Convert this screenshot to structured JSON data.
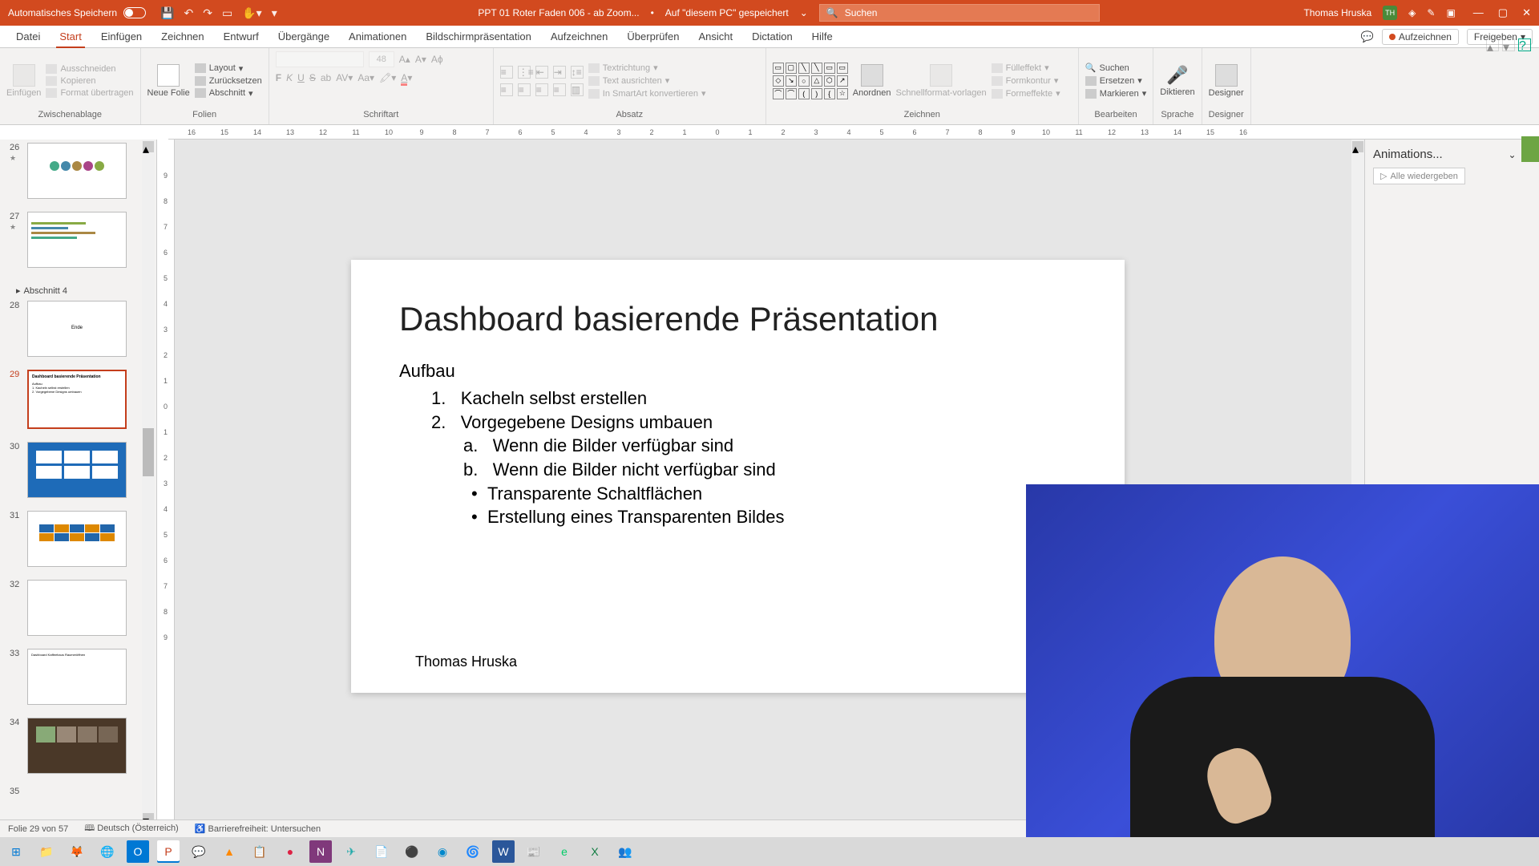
{
  "title_bar": {
    "autosave": "Automatisches Speichern",
    "filename": "PPT 01 Roter Faden 006 - ab Zoom...",
    "saved_location": "Auf \"diesem PC\" gespeichert",
    "search_placeholder": "Suchen",
    "user_name": "Thomas Hruska",
    "user_initials": "TH"
  },
  "tabs": {
    "datei": "Datei",
    "start": "Start",
    "einfuegen": "Einfügen",
    "zeichnen": "Zeichnen",
    "entwurf": "Entwurf",
    "uebergaenge": "Übergänge",
    "animationen": "Animationen",
    "bildschirm": "Bildschirmpräsentation",
    "aufzeichnen_tab": "Aufzeichnen",
    "ueberpruefen": "Überprüfen",
    "ansicht": "Ansicht",
    "dictation": "Dictation",
    "hilfe": "Hilfe",
    "aufzeichnen_btn": "Aufzeichnen",
    "freigeben": "Freigeben"
  },
  "ribbon": {
    "clipboard": {
      "label": "Zwischenablage",
      "paste": "Einfügen",
      "cut": "Ausschneiden",
      "copy": "Kopieren",
      "format": "Format übertragen"
    },
    "slides": {
      "label": "Folien",
      "new_slide": "Neue Folie",
      "layout": "Layout",
      "reset": "Zurücksetzen",
      "section": "Abschnitt"
    },
    "font": {
      "label": "Schriftart",
      "size": "48",
      "bold": "F",
      "italic": "K",
      "underline": "U",
      "strike": "S"
    },
    "paragraph": {
      "label": "Absatz",
      "text_direction": "Textrichtung",
      "align_text": "Text ausrichten",
      "smartart": "In SmartArt konvertieren"
    },
    "drawing": {
      "label": "Zeichnen",
      "arrange": "Anordnen",
      "quick_styles": "Schnellformat-vorlagen",
      "fill": "Fülleffekt",
      "outline": "Formkontur",
      "effects": "Formeffekte"
    },
    "editing": {
      "label": "Bearbeiten",
      "find": "Suchen",
      "replace": "Ersetzen",
      "select": "Markieren"
    },
    "voice": {
      "label": "Sprache",
      "dictate": "Diktieren"
    },
    "designer": {
      "label": "Designer",
      "btn": "Designer"
    }
  },
  "thumbs": {
    "n26": "26",
    "n27": "27",
    "section4": "Abschnitt 4",
    "n28": "28",
    "n29": "29",
    "n30": "30",
    "n31": "31",
    "n32": "32",
    "n33": "33",
    "n34": "34",
    "n35": "35",
    "t28_text": "Ende",
    "t33_text": "Dashboard\nKaffeehaus Raumeröffnen"
  },
  "slide": {
    "title": "Dashboard basierende Präsentation",
    "aufbau": "Aufbau",
    "item1_num": "1.",
    "item1": "Kacheln selbst erstellen",
    "item2_num": "2.",
    "item2": "Vorgegebene Designs umbauen",
    "item2a_num": "a.",
    "item2a": "Wenn  die Bilder verfügbar sind",
    "item2b_num": "b.",
    "item2b": "Wenn die Bilder nicht verfügbar sind",
    "bullet1": "Transparente Schaltflächen",
    "bullet2": "Erstellung eines Transparenten Bildes",
    "author": "Thomas Hruska"
  },
  "anim_panel": {
    "title": "Animations...",
    "play_all": "Alle wiedergeben"
  },
  "status": {
    "slide_info": "Folie 29 von 57",
    "language": "Deutsch (Österreich)",
    "accessibility": "Barrierefreiheit: Untersuchen"
  },
  "ruler_h": [
    "16",
    "15",
    "14",
    "13",
    "12",
    "11",
    "10",
    "9",
    "8",
    "7",
    "6",
    "5",
    "4",
    "3",
    "2",
    "1",
    "0",
    "1",
    "2",
    "3",
    "4",
    "5",
    "6",
    "7",
    "8",
    "9",
    "10",
    "11",
    "12",
    "13",
    "14",
    "15",
    "16"
  ],
  "ruler_v": [
    "9",
    "8",
    "7",
    "6",
    "5",
    "4",
    "3",
    "2",
    "1",
    "0",
    "1",
    "2",
    "3",
    "4",
    "5",
    "6",
    "7",
    "8",
    "9"
  ]
}
